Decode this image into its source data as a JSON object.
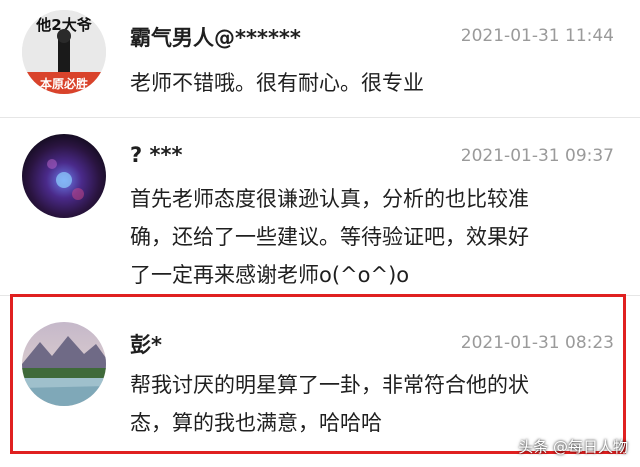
{
  "comments": [
    {
      "username": "霸气男人@******",
      "timestamp": "2021-01-31 11:44",
      "text": "老师不错哦。很有耐心。很专业",
      "avatar_text_top": "他2大爷",
      "avatar_text_bottom": "本原必胜"
    },
    {
      "username": "? ***",
      "timestamp": "2021-01-31 09:37",
      "text_lines": [
        "首先老师态度很谦逊认真，分析的也比较准",
        "确，还给了一些建议。等待验证吧，效果好",
        "了一定再来感谢老师o(^o^)o"
      ]
    },
    {
      "username": "彭*",
      "timestamp": "2021-01-31 08:23",
      "text_lines": [
        "帮我讨厌的明星算了一卦，非常符合他的状",
        "态，算的我也满意，哈哈哈"
      ]
    }
  ],
  "watermark": "头条 @每日人物",
  "colors": {
    "highlight": "#e02020",
    "timestamp": "#9a9a9a"
  }
}
